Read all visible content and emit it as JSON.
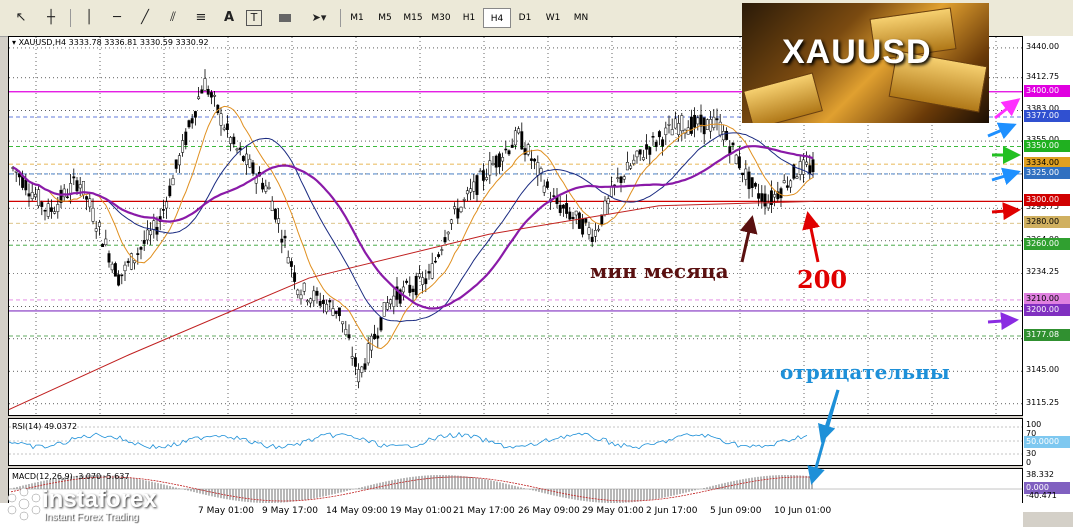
{
  "toolbar": {
    "tools": [
      "cursor",
      "crosshair",
      "vertical-line",
      "horizontal-line",
      "trend-line",
      "fibo-channel",
      "fibo-retracement",
      "text",
      "text-label",
      "rectangle",
      "arrows"
    ],
    "text_tool_label": "A",
    "label_tool_label": "T",
    "timeframes": [
      "M1",
      "M5",
      "M15",
      "M30",
      "H1",
      "H4",
      "D1",
      "W1",
      "MN"
    ],
    "active_timeframe": "H4"
  },
  "chart": {
    "info": "XAUUSD,H4  3333.78 3336.81 3330.59 3330.92",
    "banner_title": "XAUUSD",
    "annotations": {
      "month_min": "мин месяца",
      "ma200": "200",
      "negative": "отрицательны"
    }
  },
  "price_axis": {
    "ticks": [
      "3440.00",
      "3412.75",
      "3383.00",
      "3355.00",
      "3325.00",
      "3293.75",
      "3264.00",
      "3234.25",
      "3204.00",
      "3174.50",
      "3145.00",
      "3115.25"
    ],
    "levels": [
      {
        "value": "3400.00",
        "color": "#e000e0"
      },
      {
        "value": "3377.00",
        "color": "#3050d0"
      },
      {
        "value": "3350.00",
        "color": "#20b020"
      },
      {
        "value": "3334.00",
        "color": "#e0a020"
      },
      {
        "value": "3325.00",
        "color": "#3070c0"
      },
      {
        "value": "3300.00",
        "color": "#d00000"
      },
      {
        "value": "3280.00",
        "color": "#d0b060"
      },
      {
        "value": "3260.00",
        "color": "#30a030"
      },
      {
        "value": "3210.00",
        "color": "#e080e0"
      },
      {
        "value": "3200.00",
        "color": "#8030c0"
      },
      {
        "value": "3177.08",
        "color": "#309030"
      }
    ]
  },
  "rsi": {
    "label": "RSI(14) 49.0372",
    "scale": [
      "100",
      "70",
      "30",
      "0"
    ],
    "current": "50.0000"
  },
  "macd": {
    "label": "MACD(12,26,9) -3.070 -5.637",
    "scale": [
      "38.332",
      "0.000",
      "-40.471"
    ]
  },
  "time_axis": [
    "7 May 01:00",
    "9 May 17:00",
    "14 May 09:00",
    "19 May 01:00",
    "21 May 17:00",
    "26 May 09:00",
    "29 May 01:00",
    "2 Jun 17:00",
    "5 Jun 09:00",
    "10 Jun 01:00"
  ],
  "logo": {
    "name": "instaforex",
    "tagline": "Instant Forex Trading"
  },
  "colors": {
    "ma_purple": "#8a1aa8",
    "ma_orange": "#e09020",
    "ma_navy": "#1a2a80",
    "ma_red": "#c02020",
    "candle": "#000000",
    "annotation_red": "#e00000",
    "annotation_dark": "#5a1010",
    "annotation_blue": "#1e90d8"
  }
}
